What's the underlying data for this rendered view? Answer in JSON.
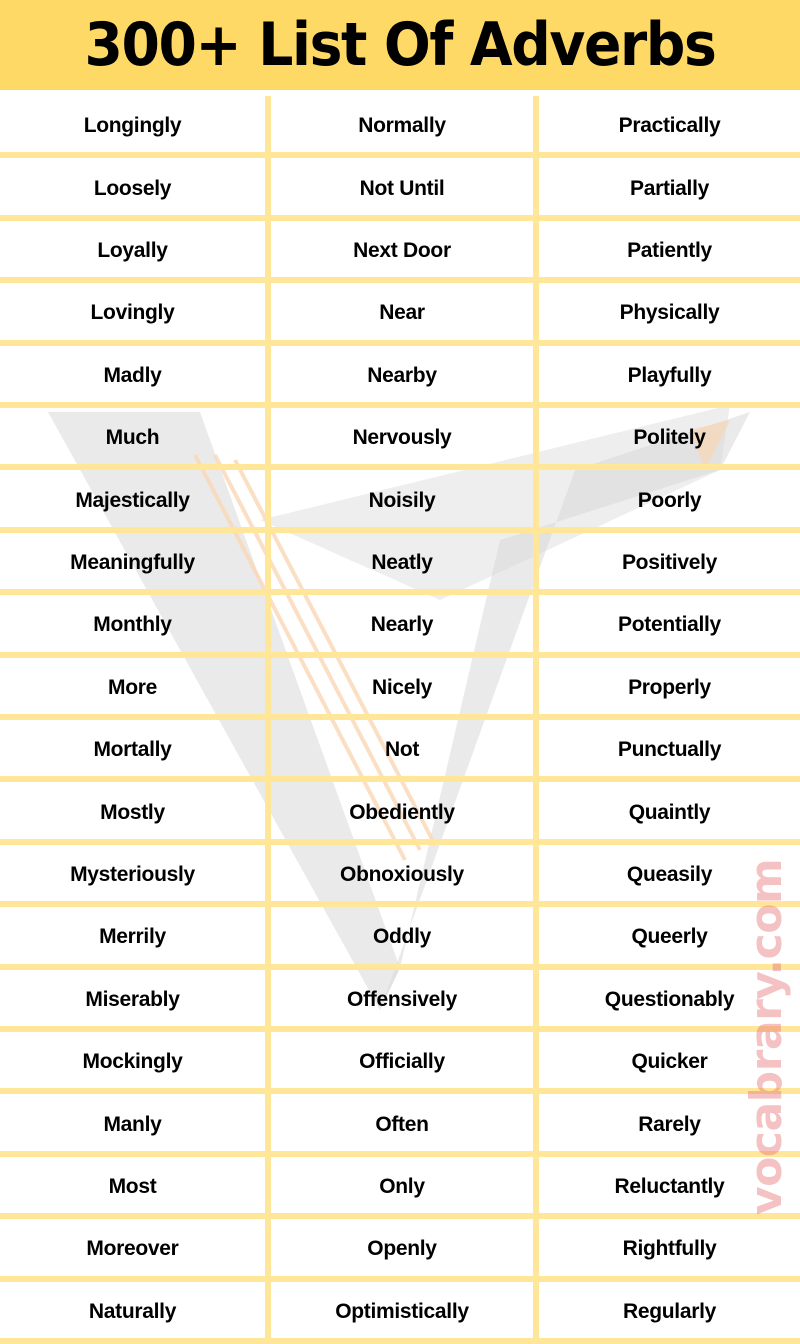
{
  "header": {
    "title": "300+ List Of Adverbs"
  },
  "colors": {
    "header_background": "#FFD966",
    "grid_lines": "#FFE699",
    "text": "#000000",
    "watermark_text": "#E67878"
  },
  "watermark": {
    "site": "vocabrary.com",
    "logo_icon": "v-logo-icon"
  },
  "columns": [
    {
      "name": "column-1",
      "words": [
        "Longingly",
        "Loosely",
        "Loyally",
        "Lovingly",
        "Madly",
        "Much",
        "Majestically",
        "Meaningfully",
        "Monthly",
        "More",
        "Mortally",
        "Mostly",
        "Mysteriously",
        "Merrily",
        "Miserably",
        "Mockingly",
        "Manly",
        "Most",
        "Moreover",
        "Naturally"
      ]
    },
    {
      "name": "column-2",
      "words": [
        "Normally",
        "Not Until",
        "Next Door",
        "Near",
        "Nearby",
        "Nervously",
        "Noisily",
        "Neatly",
        "Nearly",
        "Nicely",
        "Not",
        "Obediently",
        "Obnoxiously",
        "Oddly",
        "Offensively",
        "Officially",
        "Often",
        "Only",
        "Openly",
        "Optimistically"
      ]
    },
    {
      "name": "column-3",
      "words": [
        "Practically",
        "Partially",
        "Patiently",
        "Physically",
        "Playfully",
        "Politely",
        "Poorly",
        "Positively",
        "Potentially",
        "Properly",
        "Punctually",
        "Quaintly",
        "Queasily",
        "Queerly",
        "Questionably",
        "Quicker",
        "Rarely",
        "Reluctantly",
        "Rightfully",
        "Regularly"
      ]
    }
  ]
}
